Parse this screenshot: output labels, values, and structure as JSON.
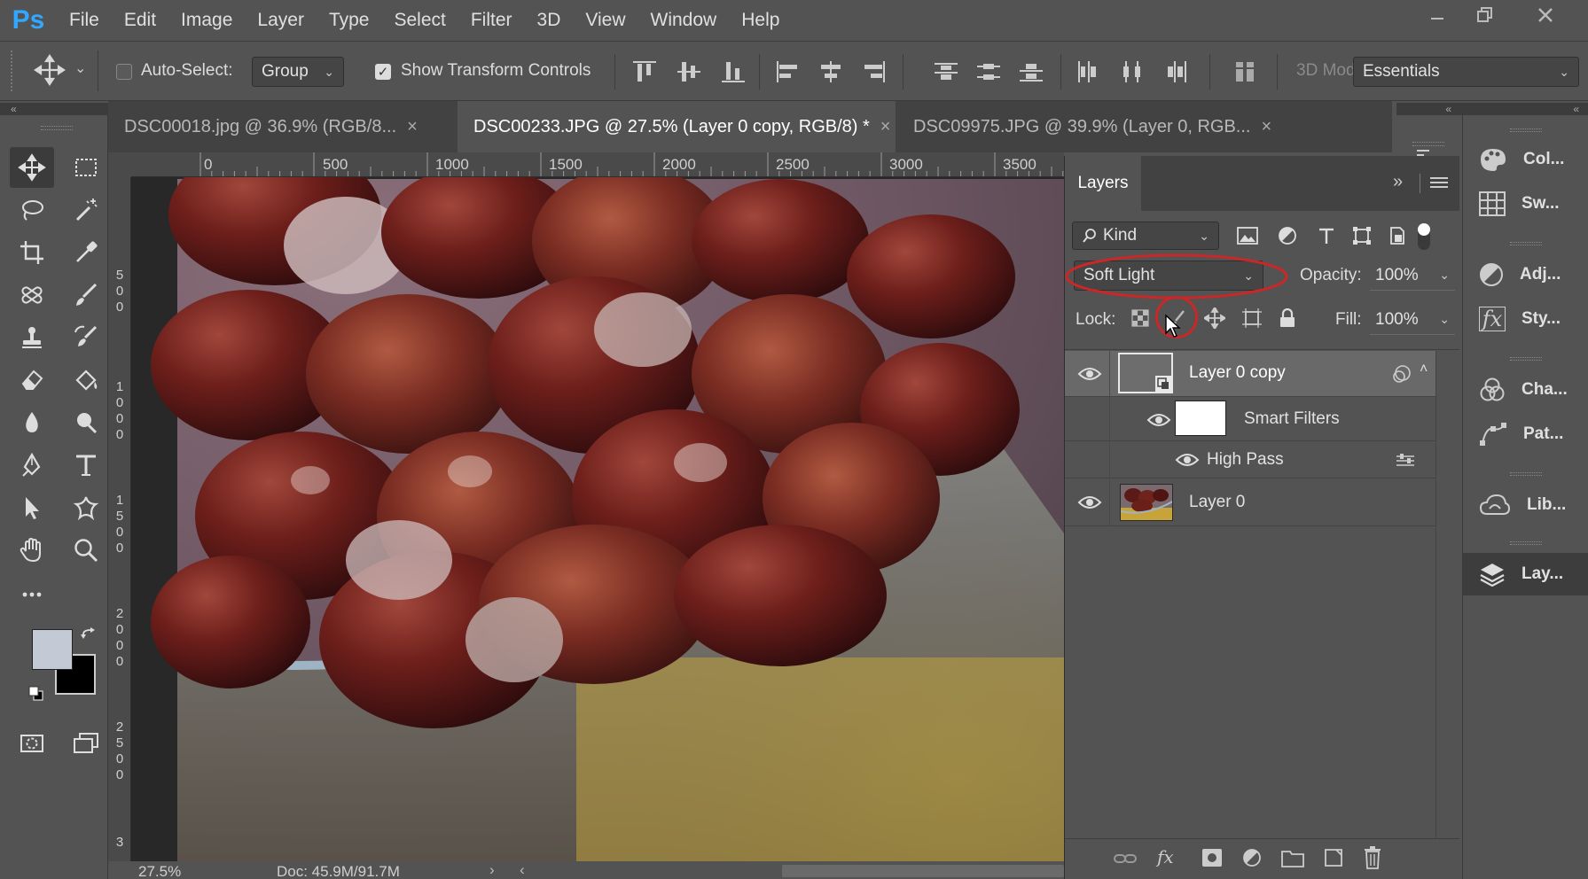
{
  "app": {
    "logo": "Ps",
    "menu": [
      "File",
      "Edit",
      "Image",
      "Layer",
      "Type",
      "Select",
      "Filter",
      "3D",
      "View",
      "Window",
      "Help"
    ],
    "window_controls": [
      "minimize-icon",
      "restore-icon",
      "close-icon"
    ]
  },
  "options": {
    "auto_select_label": "Auto-Select:",
    "auto_select_checked": false,
    "auto_select_target": "Group",
    "show_transform_label": "Show Transform Controls",
    "show_transform_checked": true,
    "mode_3d_label": "3D Mod",
    "workspace": "Essentials"
  },
  "tabs": [
    {
      "label": "DSC00018.jpg @ 36.9% (RGB/8...",
      "active": false
    },
    {
      "label": "DSC00233.JPG @ 27.5% (Layer 0 copy, RGB/8) *",
      "active": true
    },
    {
      "label": "DSC09975.JPG @ 39.9% (Layer 0, RGB...",
      "active": false
    }
  ],
  "rulers": {
    "horizontal": [
      "0",
      "500",
      "1000",
      "1500",
      "2000",
      "2500",
      "3000",
      "3500"
    ],
    "vertical": [
      "500",
      "1000",
      "1500",
      "2000",
      "2500",
      "3"
    ]
  },
  "status": {
    "zoom": "27.5%",
    "doc": "Doc: 45.9M/91.7M"
  },
  "colors": {
    "foreground": "#c3cad6",
    "background": "#000000",
    "accent_blue": "#31a8ff",
    "annotation_red": "#c82828"
  },
  "layers_panel": {
    "title": "Layers",
    "filter_kind": "Kind",
    "blend_mode": "Soft Light",
    "opacity_label": "Opacity:",
    "opacity_value": "100%",
    "lock_label": "Lock:",
    "fill_label": "Fill:",
    "fill_value": "100%",
    "layers": [
      {
        "name": "Layer 0 copy",
        "selected": true,
        "visible": true,
        "type": "smart-object"
      },
      {
        "name": "Smart Filters",
        "visible": true,
        "type": "smart-filters"
      },
      {
        "name": "High Pass",
        "visible": true,
        "type": "filter"
      },
      {
        "name": "Layer 0",
        "visible": true,
        "type": "pixel"
      }
    ]
  },
  "right_dock": [
    {
      "label": "Col...",
      "icon": "color-palette-icon"
    },
    {
      "label": "Sw...",
      "icon": "swatches-grid-icon"
    },
    {
      "label": "Adj...",
      "icon": "adjustments-icon"
    },
    {
      "label": "Sty...",
      "icon": "styles-fx-icon"
    },
    {
      "label": "Cha...",
      "icon": "channels-icon"
    },
    {
      "label": "Pat...",
      "icon": "paths-icon"
    },
    {
      "label": "Lib...",
      "icon": "libraries-icon"
    },
    {
      "label": "Lay...",
      "icon": "layers-icon",
      "active": true
    }
  ]
}
